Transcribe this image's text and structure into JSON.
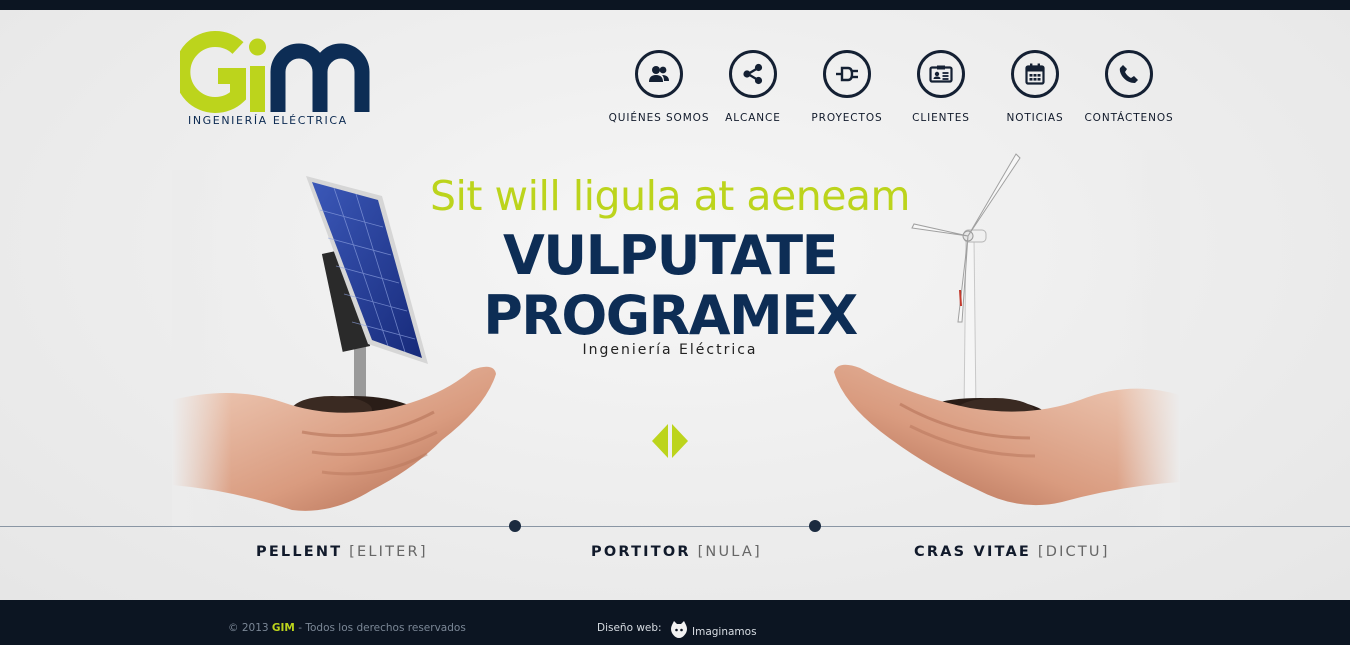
{
  "brand": {
    "logo_text": "GIM",
    "logo_subtitle": "INGENIERÍA ELÉCTRICA"
  },
  "nav": {
    "items": [
      {
        "label": "QUIÉNES SOMOS",
        "icon": "users-icon"
      },
      {
        "label": "ALCANCE",
        "icon": "share-icon"
      },
      {
        "label": "PROYECTOS",
        "icon": "plug-icon"
      },
      {
        "label": "CLIENTES",
        "icon": "id-card-icon"
      },
      {
        "label": "NOTICIAS",
        "icon": "calendar-icon"
      },
      {
        "label": "CONTÁCTENOS",
        "icon": "phone-icon"
      }
    ]
  },
  "hero": {
    "kicker": "Sit will ligula at aeneam",
    "title_line1": "VULPUTATE",
    "title_line2": "PROGRAMEX",
    "subtitle": "Ingeniería Eléctrica"
  },
  "features": [
    {
      "strong": "PELLENT",
      "light": "[ELITER]"
    },
    {
      "strong": "PORTITOR",
      "light": "[NULA]"
    },
    {
      "strong": "CRAS VITAE",
      "light": "[DICTU]"
    }
  ],
  "footer": {
    "copyright_prefix": "© 2013",
    "copyright_brand": "GIM",
    "copyright_suffix": "- Todos los derechos reservados",
    "design_label": "Diseño web:",
    "design_name": "Imaginamos"
  },
  "colors": {
    "accent_green": "#bcd41c",
    "navy": "#0d2d55",
    "dark_bar": "#0c1522"
  }
}
